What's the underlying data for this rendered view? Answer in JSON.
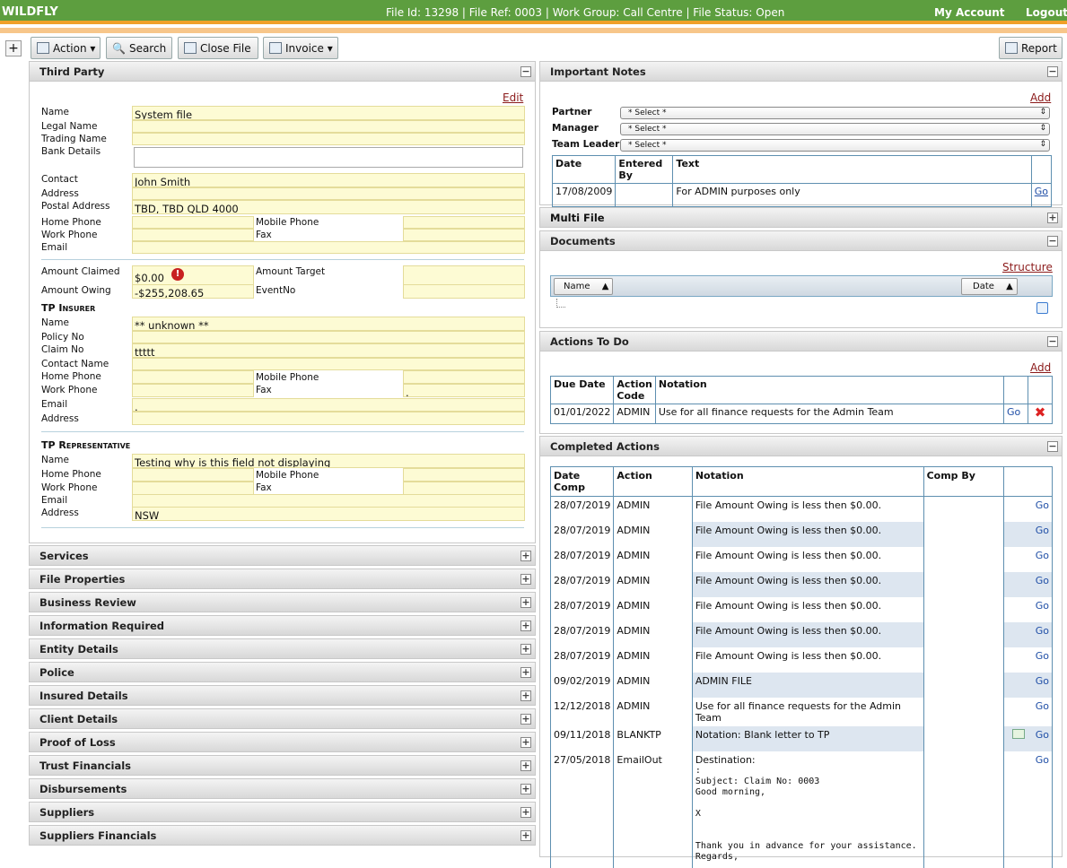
{
  "header": {
    "brand": "WILDFLY",
    "info": "File Id: 13298 | File Ref: 0003 | Work Group: Call Centre | File Status: Open",
    "account": "My Account",
    "logout": "Logout"
  },
  "toolbar": {
    "expand": "+",
    "action": "Action",
    "search": "Search",
    "close_file": "Close File",
    "invoice": "Invoice",
    "report": "Report"
  },
  "third_party": {
    "title": "Third Party",
    "edit": "Edit",
    "labels": {
      "name": "Name",
      "legal_name": "Legal Name",
      "trading_name": "Trading Name",
      "bank_details": "Bank Details",
      "contact": "Contact",
      "address": "Address",
      "postal_address": "Postal Address",
      "home_phone": "Home Phone",
      "mobile_phone": "Mobile Phone",
      "work_phone": "Work Phone",
      "fax": "Fax",
      "email": "Email",
      "amount_claimed": "Amount Claimed",
      "amount_target": "Amount Target",
      "amount_owing": "Amount Owing",
      "event_no": "EventNo"
    },
    "values": {
      "name": "System file",
      "contact": "John Smith",
      "postal_address": "TBD, TBD QLD 4000",
      "amount_claimed": "$0.00",
      "amount_owing": "-$255,208.65"
    },
    "insurer": {
      "title": "TP Insurer",
      "labels": {
        "name": "Name",
        "policy_no": "Policy No",
        "claim_no": "Claim No",
        "contact_name": "Contact Name",
        "home_phone": "Home Phone",
        "mobile_phone": "Mobile Phone",
        "work_phone": "Work Phone",
        "fax": "Fax",
        "email": "Email",
        "address": "Address"
      },
      "values": {
        "name": "** unknown **",
        "claim_no": "ttttt",
        "fax": ".",
        "email": "."
      }
    },
    "rep": {
      "title": "TP Representative",
      "labels": {
        "name": "Name",
        "home_phone": "Home Phone",
        "mobile_phone": "Mobile Phone",
        "work_phone": "Work Phone",
        "fax": "Fax",
        "email": "Email",
        "address": "Address"
      },
      "values": {
        "name": "Testing why is this field not displaying",
        "address": "NSW"
      }
    }
  },
  "left_sections": [
    "Services",
    "File Properties",
    "Business Review",
    "Information Required",
    "Entity Details",
    "Police",
    "Insured Details",
    "Client Details",
    "Proof of Loss",
    "Trust Financials",
    "Disbursements",
    "Suppliers",
    "Suppliers Financials"
  ],
  "important_notes": {
    "title": "Important Notes",
    "add": "Add",
    "partner_label": "Partner",
    "manager_label": "Manager",
    "team_leader_label": "Team Leader",
    "select_value": "* Select *",
    "columns": [
      "Date",
      "Entered By",
      "Text"
    ],
    "row": {
      "date": "17/08/2009",
      "entered_by": "",
      "text": "For ADMIN purposes only",
      "go": "Go"
    }
  },
  "multi_file": {
    "title": "Multi File"
  },
  "documents": {
    "title": "Documents",
    "structure": "Structure",
    "col_name": "Name",
    "col_date": "Date"
  },
  "actions_todo": {
    "title": "Actions To Do",
    "add": "Add",
    "columns": [
      "Due Date",
      "Action Code",
      "Notation"
    ],
    "row": {
      "due": "01/01/2022",
      "code": "ADMIN",
      "notation": "Use for all finance requests for the Admin Team",
      "go": "Go"
    }
  },
  "completed": {
    "title": "Completed Actions",
    "columns": [
      "Date Comp",
      "Action",
      "Notation",
      "Comp By"
    ],
    "go": "Go",
    "rows": [
      {
        "date": "28/07/2019",
        "action": "ADMIN",
        "notation": "File Amount Owing is less then $0.00."
      },
      {
        "date": "28/07/2019",
        "action": "ADMIN",
        "notation": "File Amount Owing is less then $0.00."
      },
      {
        "date": "28/07/2019",
        "action": "ADMIN",
        "notation": "File Amount Owing is less then $0.00."
      },
      {
        "date": "28/07/2019",
        "action": "ADMIN",
        "notation": "File Amount Owing is less then $0.00."
      },
      {
        "date": "28/07/2019",
        "action": "ADMIN",
        "notation": "File Amount Owing is less then $0.00."
      },
      {
        "date": "28/07/2019",
        "action": "ADMIN",
        "notation": "File Amount Owing is less then $0.00."
      },
      {
        "date": "28/07/2019",
        "action": "ADMIN",
        "notation": "File Amount Owing is less then $0.00."
      },
      {
        "date": "09/02/2019",
        "action": "ADMIN",
        "notation": "ADMIN FILE"
      },
      {
        "date": "12/12/2018",
        "action": "ADMIN",
        "notation": "Use for all finance requests for the Admin Team"
      },
      {
        "date": "09/11/2018",
        "action": "BLANKTP",
        "notation": "Notation: Blank letter to TP"
      }
    ],
    "email_row": {
      "date": "27/05/2018",
      "action": "EmailOut",
      "line1": "Destination:",
      "line2": ":",
      "line3": "Subject: Claim No: 0003",
      "line4": "Good morning,",
      "line5": "X",
      "line6": "Thank you in advance for your assistance.",
      "line7": "Regards,"
    }
  }
}
